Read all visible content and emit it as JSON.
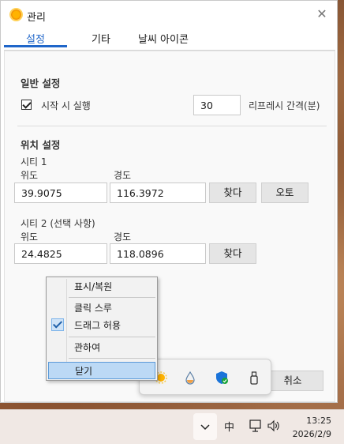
{
  "window": {
    "title": "관리",
    "close_glyph": "✕"
  },
  "tabs": [
    {
      "label": "설정",
      "active": true
    },
    {
      "label": "기타",
      "active": false
    },
    {
      "label": "날씨 아이콘",
      "active": false
    }
  ],
  "general": {
    "section_title": "일반 설정",
    "startup_checkbox": {
      "label": "시작 시 실행",
      "checked": true
    },
    "refresh_value": "30",
    "refresh_label": "리프레시 간격(분)"
  },
  "location": {
    "section_title": "위치 설정",
    "city1": {
      "label": "시티 1",
      "lat_label": "위도",
      "lon_label": "경도",
      "lat": "39.9075",
      "lon": "116.3972",
      "find_label": "찾다",
      "auto_label": "오토"
    },
    "city2": {
      "label": "시티 2 (선택 사항)",
      "lat_label": "위도",
      "lon_label": "경도",
      "lat": "24.4825",
      "lon": "118.0896",
      "find_label": "찾다"
    }
  },
  "cancel_label": "취소",
  "context_menu": {
    "items": [
      {
        "label": "표시/복원",
        "checked": false,
        "highlighted": false
      },
      {
        "label": "클릭 스루",
        "checked": false,
        "highlighted": false
      },
      {
        "label": "드래그 허용",
        "checked": true,
        "highlighted": false
      },
      {
        "label": "관하여",
        "checked": false,
        "highlighted": false
      },
      {
        "label": "닫기",
        "checked": false,
        "highlighted": true
      }
    ]
  },
  "tray_flyout": {
    "icons": [
      "weather-sun-icon",
      "water-drop-icon",
      "security-shield-icon",
      "usb-drive-icon"
    ]
  },
  "taskbar": {
    "chevron_glyph": "⌄",
    "ime_label": "中",
    "time": "13:25",
    "date": "2026/2/9"
  },
  "colors": {
    "accent": "#1f66c9",
    "menu_highlight": "#bcd9f5"
  }
}
